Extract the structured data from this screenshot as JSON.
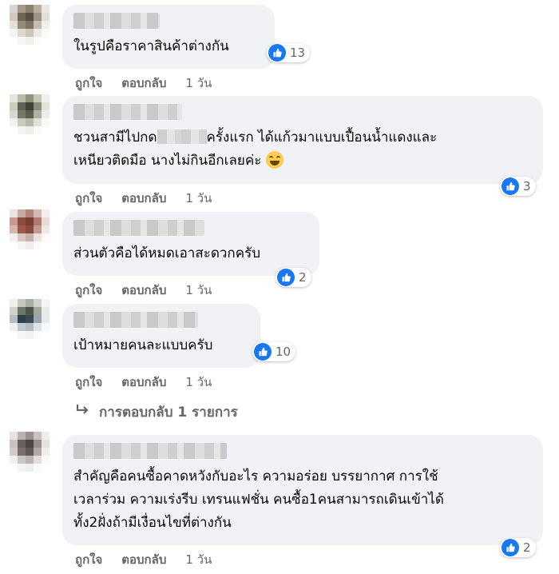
{
  "comments": [
    {
      "text": "ในรูปคือราคาสินค้าต่างกัน",
      "reactions": "13",
      "like": "ถูกใจ",
      "reply": "ตอบกลับ",
      "time": "1 วัน"
    },
    {
      "text_before": "ชวนสามีไปกด",
      "text_after": "ครั้งแรก ได้แก้วมาแบบเปื้อนน้ำแดงและ",
      "text_line2": "เหนียวติดมือ นางไม่กินอีกเลยค่ะ",
      "reactions": "3",
      "like": "ถูกใจ",
      "reply": "ตอบกลับ",
      "time": "1 วัน"
    },
    {
      "text": "ส่วนตัวคือได้หมดเอาสะดวกครับ",
      "reactions": "2",
      "like": "ถูกใจ",
      "reply": "ตอบกลับ",
      "time": "1 วัน"
    },
    {
      "text": "เป้าหมายคนละแบบครับ",
      "reactions": "10",
      "like": "ถูกใจ",
      "reply": "ตอบกลับ",
      "time": "1 วัน"
    },
    {
      "line1": "สำคัญคือคนซื้อคาดหวังกับอะไร ความอร่อย บรรยากาศ การใช้",
      "line2": "เวลาร่วม ความเร่งรีบ เทรนแฟชั่น คนซื้อ1คนสามารถเดินเข้าได้",
      "line3": "ทั้ง2ฝั่งถ้ามีเงื่อนไขที่ต่างกัน",
      "reactions": "2",
      "like": "ถูกใจ",
      "reply": "ตอบกลับ",
      "time": "1 วัน"
    }
  ],
  "view_replies": "การตอบกลับ 1 รายการ",
  "colors": {
    "like_blue": "#1877f2",
    "bubble": "#f0f2f5",
    "meta": "#65676b"
  }
}
